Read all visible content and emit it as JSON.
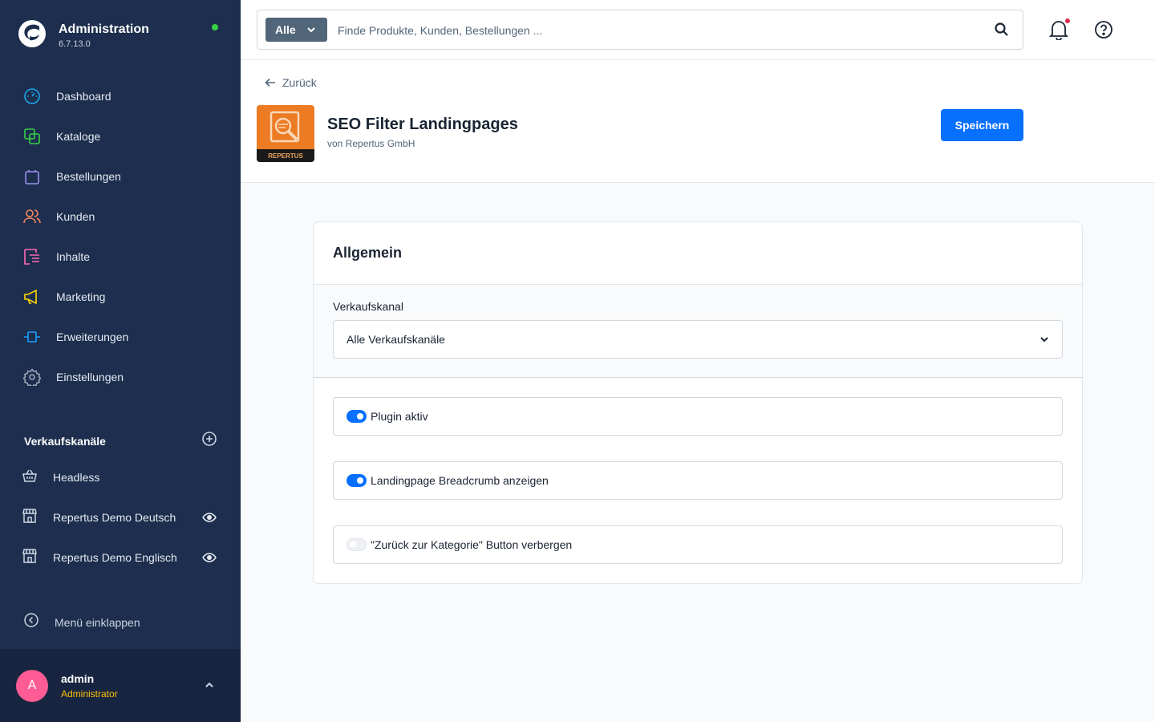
{
  "app": {
    "title": "Administration",
    "version": "6.7.13.0"
  },
  "nav": {
    "items": [
      {
        "label": "Dashboard",
        "icon": "dashboard-icon",
        "color": "#1ba8ec"
      },
      {
        "label": "Kataloge",
        "icon": "catalog-icon",
        "color": "#37d046"
      },
      {
        "label": "Bestellungen",
        "icon": "bag-icon",
        "color": "#a092f0"
      },
      {
        "label": "Kunden",
        "icon": "users-icon",
        "color": "#f88962"
      },
      {
        "label": "Inhalte",
        "icon": "content-icon",
        "color": "#ff68b4"
      },
      {
        "label": "Marketing",
        "icon": "megaphone-icon",
        "color": "#ffd700"
      },
      {
        "label": "Erweiterungen",
        "icon": "plugin-icon",
        "color": "#189eff"
      },
      {
        "label": "Einstellungen",
        "icon": "gear-icon",
        "color": "#9aa8b5"
      }
    ]
  },
  "sales_channels": {
    "title": "Verkaufskanäle",
    "items": [
      {
        "label": "Headless",
        "icon": "basket-icon"
      },
      {
        "label": "Repertus Demo Deutsch",
        "icon": "storefront-icon"
      },
      {
        "label": "Repertus Demo Englisch",
        "icon": "storefront-icon"
      }
    ]
  },
  "sidebar": {
    "collapse_label": "Menü einklappen"
  },
  "user": {
    "initial": "A",
    "name": "admin",
    "role": "Administrator"
  },
  "search": {
    "type_label": "Alle",
    "placeholder": "Finde Produkte, Kunden, Bestellungen ..."
  },
  "header": {
    "back_label": "Zurück",
    "plugin_title": "SEO Filter Landingpages",
    "plugin_vendor": "von Repertus GmbH",
    "plugin_icon_text": "REPERTUS",
    "save_label": "Speichern"
  },
  "card": {
    "title": "Allgemein",
    "sales_channel_label": "Verkaufskanal",
    "sales_channel_value": "Alle Verkaufskanäle",
    "switches": [
      {
        "label": "Plugin aktiv",
        "checked": true
      },
      {
        "label": "Landingpage Breadcrumb anzeigen",
        "checked": true
      },
      {
        "label": "\"Zurück zur Kategorie\" Button verbergen",
        "checked": false
      }
    ]
  },
  "colors": {
    "sidebar_bg": "#1d2e4e",
    "accent": "#0870ff",
    "status_online": "#37d046",
    "notification": "#de294c",
    "avatar": "#ff5c95"
  }
}
